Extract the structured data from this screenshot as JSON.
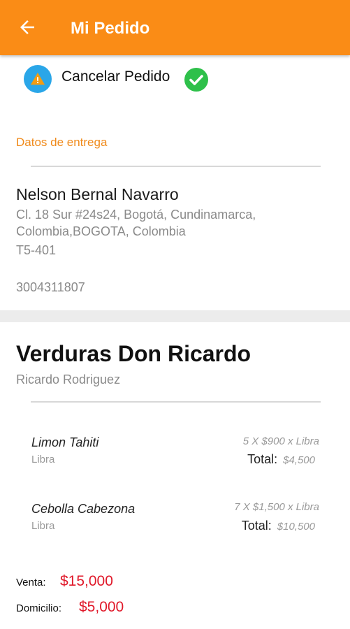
{
  "appbar": {
    "title": "Mi Pedido",
    "back_icon": "arrow-back-icon",
    "color": "#fa8c16"
  },
  "actions": {
    "cancel_label": "Cancelar Pedido",
    "warning_icon": "warning-icon",
    "status_icon": "check-circle-icon"
  },
  "delivery": {
    "section_label": "Datos de entrega",
    "customer_name": "Nelson Bernal Navarro",
    "address": "Cl. 18 Sur #24s24, Bogotá, Cundinamarca, Colombia,BOGOTA, Colombia",
    "unit": "T5-401",
    "phone": "3004311807"
  },
  "store": {
    "name": "Verduras Don Ricardo",
    "owner": "Ricardo Rodriguez"
  },
  "items": [
    {
      "name": "Limon Tahiti",
      "unit": "Libra",
      "quantity_line": "5 X $900 x Libra",
      "total_label": "Total:",
      "total": "$4,500"
    },
    {
      "name": "Cebolla Cabezona",
      "unit": "Libra",
      "quantity_line": "7 X $1,500 x Libra",
      "total_label": "Total:",
      "total": "$10,500"
    }
  ],
  "summary": {
    "sale_label": "Venta:",
    "sale_value": "$15,000",
    "delivery_label": "Domicilio:",
    "delivery_value": "$5,000",
    "value_color": "#e0192a"
  }
}
